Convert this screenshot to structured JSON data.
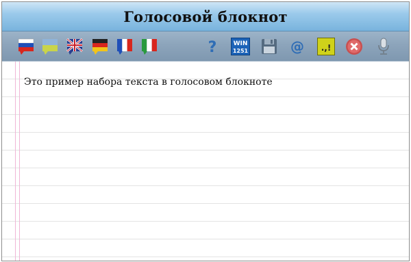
{
  "window": {
    "title": "Голосовой блокнот"
  },
  "toolbar": {
    "languages": [
      {
        "icon": "russian-flag-icon"
      },
      {
        "icon": "ukrainian-flag-icon"
      },
      {
        "icon": "british-flag-icon"
      },
      {
        "icon": "german-flag-icon"
      },
      {
        "icon": "french-flag-icon"
      },
      {
        "icon": "italian-flag-icon"
      }
    ],
    "actions": [
      {
        "icon": "help-icon"
      },
      {
        "icon": "encoding-icon",
        "label_top": "WIN",
        "label_bottom": "1251"
      },
      {
        "icon": "save-icon"
      },
      {
        "icon": "email-icon",
        "glyph": "@"
      },
      {
        "icon": "punctuation-icon",
        "glyph": ".,!"
      },
      {
        "icon": "clear-icon"
      },
      {
        "icon": "microphone-icon"
      }
    ]
  },
  "document": {
    "text": "Это пример набора текста в голосовом блокноте"
  },
  "colors": {
    "title_bar": "#8ec2e8",
    "toolbar": "#8ba3ba",
    "margin_line": "#f0b6d6",
    "ruled_line": "#e3e3e3"
  }
}
